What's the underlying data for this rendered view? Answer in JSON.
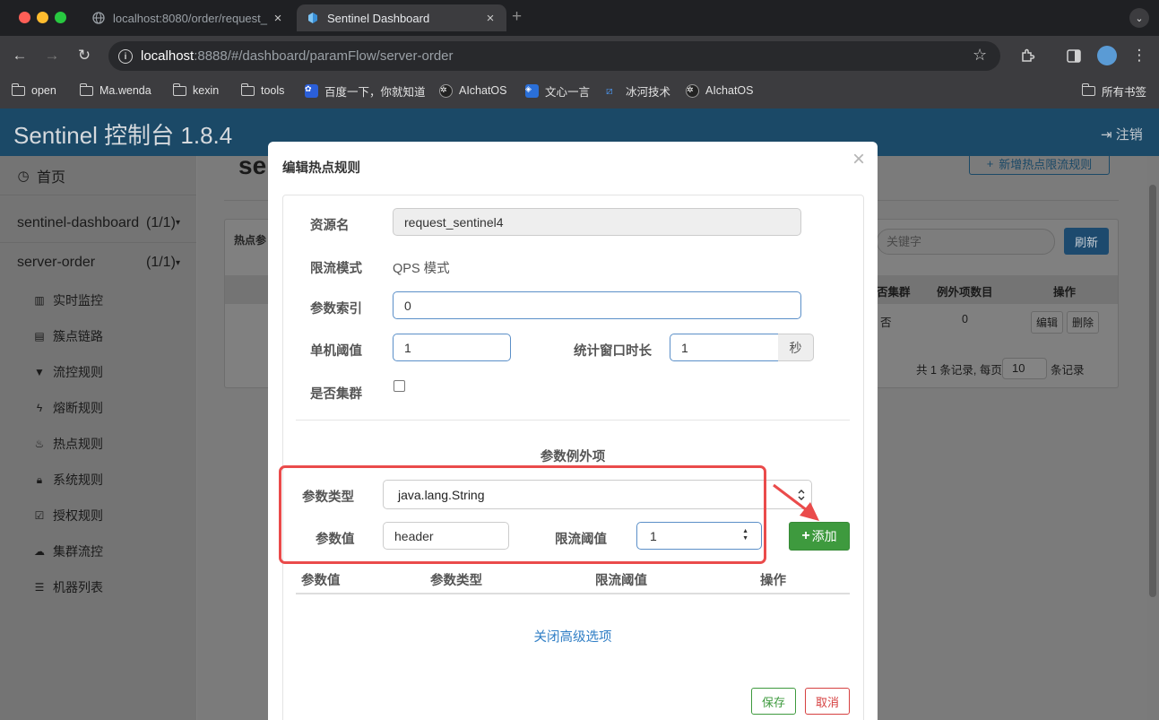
{
  "browser": {
    "tabs": [
      {
        "title": "localhost:8080/order/request_",
        "active": false
      },
      {
        "title": "Sentinel Dashboard",
        "active": true
      }
    ],
    "url_host": "localhost",
    "url_rest": ":8888/#/dashboard/paramFlow/server-order",
    "bookmarks": [
      "open",
      "Ma.wenda",
      "kexin",
      "tools",
      "百度一下，你就知道",
      "AIchatOS",
      "文心一言",
      "冰河技术",
      "AIchatOS"
    ],
    "all_bookmarks": "所有书签",
    "colors": {
      "tabstrip": "#1f2023",
      "toolbar": "#3c3c3f"
    }
  },
  "app": {
    "brand": "Sentinel 控制台 1.8.4",
    "logout": "注销",
    "colors": {
      "topbar": "#1b4967"
    }
  },
  "sidebar": {
    "home": "首页",
    "apps": [
      {
        "name": "sentinel-dashboard",
        "count": "(1/1)"
      },
      {
        "name": "server-order",
        "count": "(1/1)"
      }
    ],
    "items": [
      "实时监控",
      "簇点链路",
      "流控规则",
      "熔断规则",
      "热点规则",
      "系统规则",
      "授权规则",
      "集群流控",
      "机器列表"
    ]
  },
  "background_page": {
    "title_fragment": "se",
    "new_rule_button": "新增热点限流规则",
    "panel_heading": "热点参",
    "search_placeholder": "关键字",
    "refresh_button": "刷新",
    "headers": [
      "否集群",
      "例外项数目",
      "操作"
    ],
    "row": {
      "cluster": "否",
      "exceptions": "0",
      "edit": "编辑",
      "delete": "删除"
    },
    "pagination": {
      "prefix": "共 1 条记录, 每页",
      "page_size": "10",
      "suffix": "条记录"
    }
  },
  "modal": {
    "title": "编辑热点规则",
    "close": "×",
    "resource_label": "资源名",
    "resource_value": "request_sentinel4",
    "mode_label": "限流模式",
    "mode_value": "QPS 模式",
    "param_index_label": "参数索引",
    "param_index_value": "0",
    "threshold_label": "单机阈值",
    "threshold_value": "1",
    "window_label": "统计窗口时长",
    "window_value": "1",
    "window_unit": "秒",
    "cluster_label": "是否集群",
    "cluster_checked": false,
    "exceptions_title": "参数例外项",
    "param_type_label": "参数类型",
    "param_type_value": "java.lang.String",
    "param_value_label": "参数值",
    "param_value_value": "header",
    "limit_threshold_label": "限流阈值",
    "limit_threshold_value": "1",
    "add_button": "添加",
    "table_headers": [
      "参数值",
      "参数类型",
      "限流阈值",
      "操作"
    ],
    "advanced_link": "关闭高级选项",
    "save_button": "保存",
    "cancel_button": "取消",
    "colors": {
      "add": "#3e9a3e",
      "save": "#3e9a3e",
      "cancel": "#d64040",
      "link": "#2f7ec5",
      "annotation": "#ea4b4b"
    }
  }
}
